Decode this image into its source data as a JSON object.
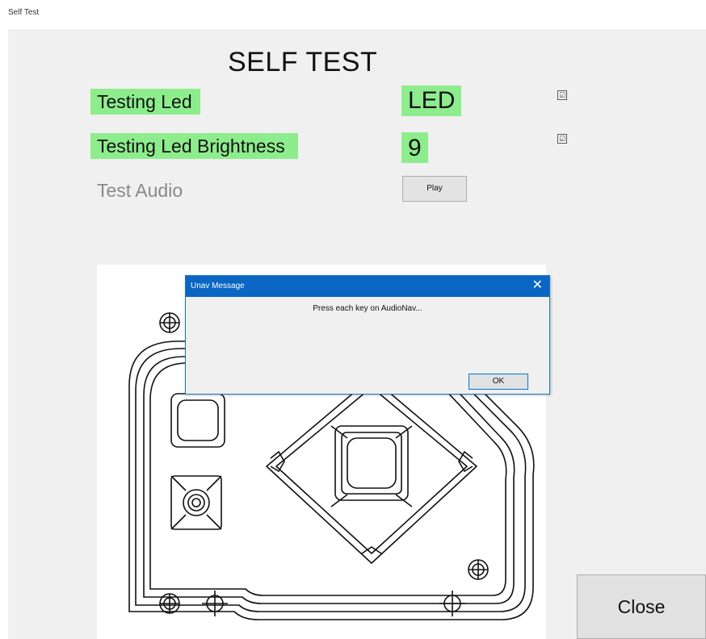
{
  "window": {
    "title": "Self Test"
  },
  "heading": "SELF TEST",
  "tests": {
    "led": {
      "label": "Testing Led",
      "value": "LED",
      "checked": true
    },
    "brightness": {
      "label": "Testing Led Brightness",
      "value": "9",
      "checked": true
    },
    "audio": {
      "label": "Test Audio",
      "button": "Play"
    }
  },
  "close_label": "Close",
  "dialog": {
    "title": "Unav Message",
    "close_glyph": "✕",
    "message": "Press each key  on AudioNav...",
    "ok_label": "OK"
  },
  "check_glyph": "☑",
  "colors": {
    "highlight": "#8ded8d",
    "dialog_titlebar": "#0a66c2",
    "panel": "#f0f0f0"
  },
  "icons": {
    "drawing": "device-technical-drawing",
    "check": "checkbox-checked-icon",
    "close": "close-x-icon"
  }
}
